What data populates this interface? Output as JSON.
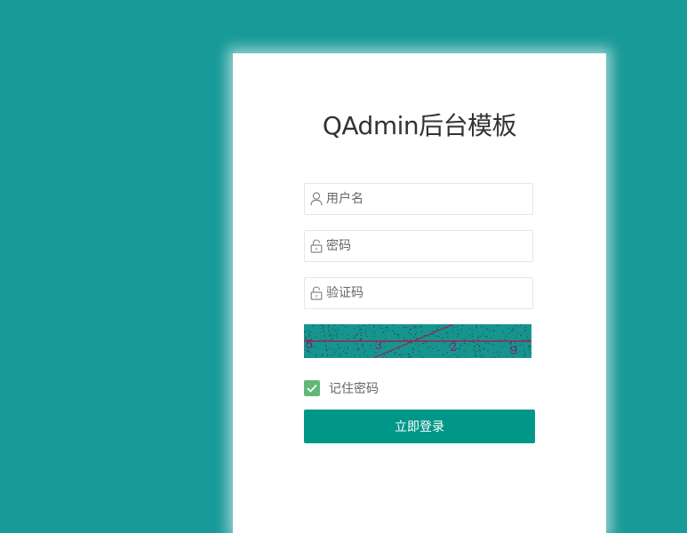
{
  "login": {
    "title": "QAdmin后台模板",
    "username_placeholder": "用户名",
    "password_placeholder": "密码",
    "captcha_placeholder": "验证码",
    "captcha_text": [
      "5",
      "3",
      "2",
      "9"
    ],
    "remember_label": "记住密码",
    "remember_checked": true,
    "submit_label": "立即登录"
  },
  "colors": {
    "page_background": "#189a98",
    "card_background": "#ffffff",
    "button": "#009688",
    "checkbox": "#5fb878",
    "captcha_background": "#169590",
    "captcha_text": "#8b1d6b"
  },
  "icons": {
    "username": "user-icon",
    "password": "lock-icon",
    "captcha": "lock-icon",
    "remember": "check-icon"
  }
}
